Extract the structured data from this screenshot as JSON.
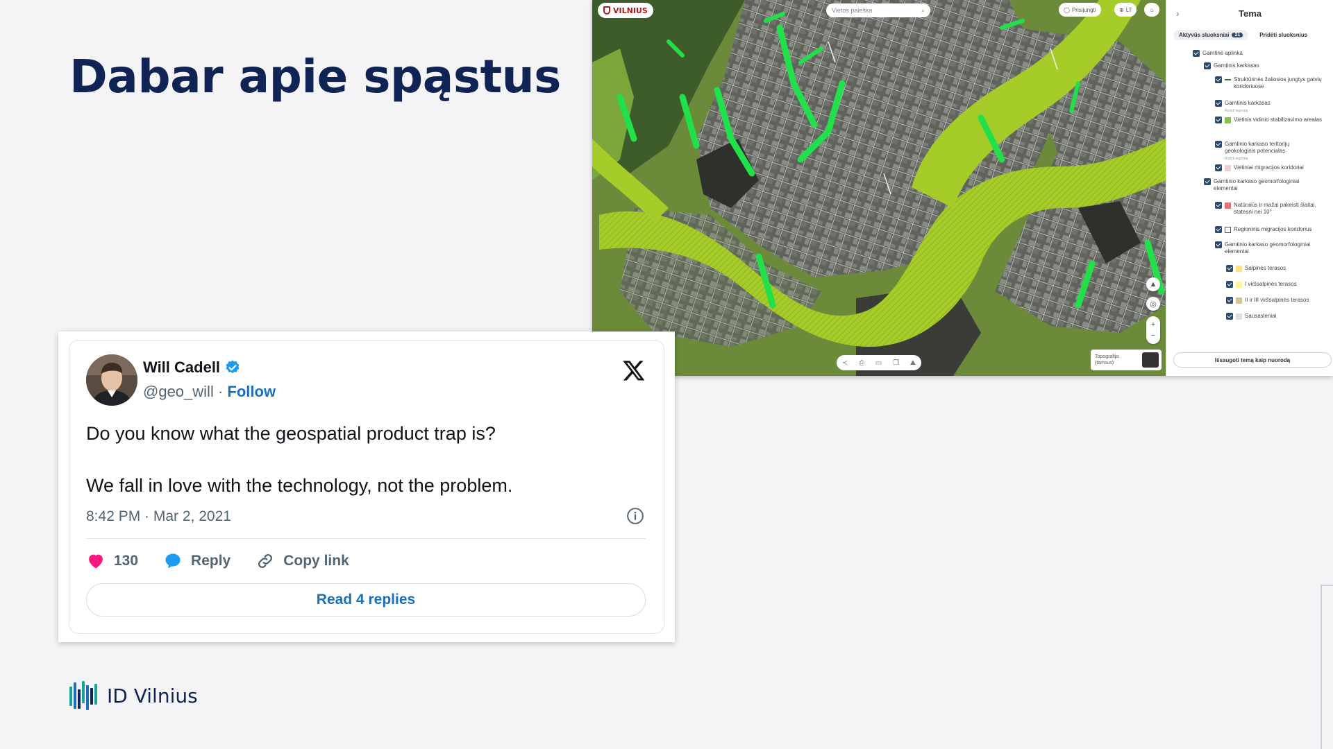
{
  "slide": {
    "title": "Dabar apie spąstus",
    "logo_text": "ID Vilnius"
  },
  "map_app": {
    "brand": "VILNIUS",
    "search_placeholder": "Vietos paieška",
    "login_label": "Prisijungti",
    "language_label": "LT",
    "basemap_label_line1": "Topografija",
    "basemap_label_line2": "(tamsus)",
    "panel": {
      "title": "Tema",
      "tab_active": "Aktyvūs sluoksniai",
      "tab_active_count": "21",
      "tab_add": "Pridėti sluoksnius",
      "save_button": "Išsaugoti temą kaip nuorodą",
      "legend_link": "Rodyti legendą",
      "layers": [
        {
          "label": "Gamtinė aplinka",
          "swatch": ""
        },
        {
          "label": "Gamtinis karkasas",
          "swatch": ""
        },
        {
          "label": "Struktūrinės žaliosios jungtys gatvių koridoriuose",
          "swatch": "#2e7d32"
        },
        {
          "label": "Gamtinis karkasas",
          "swatch": ""
        },
        {
          "label": "Vietinis vidinio stabilizavimo arealas",
          "swatch": "#8bc34a"
        },
        {
          "label": "Gamtinio karkaso teritorijų geokologinis potencialas",
          "swatch": ""
        },
        {
          "label": "Vietiniai migracijos koridoriai",
          "swatch": "#e8d0d0"
        },
        {
          "label": "Gamtinio karkaso geomorfologiniai elementai",
          "swatch": ""
        },
        {
          "label": "Natūralūs ir mažai pakeisti šlaitai, statesni nei 10°",
          "swatch": "#e57373"
        },
        {
          "label": "Regioninis migracijos koridorius",
          "swatch": "#ffffff"
        },
        {
          "label": "Gamtinio karkaso geomorfologiniai elementai",
          "swatch": ""
        },
        {
          "label": "Salpinės terasos",
          "swatch": "#ffe082"
        },
        {
          "label": "I viršsalpinės terasos",
          "swatch": "#fff59d"
        },
        {
          "label": "II ir III viršsalpinės terasos",
          "swatch": "#d4c68a"
        },
        {
          "label": "Sausasleniai",
          "swatch": "#e0e0e0"
        }
      ]
    }
  },
  "tweet": {
    "author": "Will Cadell",
    "handle": "@geo_will",
    "separator": "·",
    "follow": "Follow",
    "text_line1": "Do you know what the geospatial product trap is?",
    "text_line2": "We fall in love with the technology, not the problem.",
    "timestamp": "8:42 PM · Mar 2, 2021",
    "likes": "130",
    "reply": "Reply",
    "copy_link": "Copy link",
    "read_replies": "Read 4 replies"
  },
  "colors": {
    "title": "#0f2454",
    "link_blue": "#1d6fb8",
    "like_pink": "#f91880",
    "reply_blue": "#1d9bf0",
    "verified_blue": "#1d9bf0"
  }
}
